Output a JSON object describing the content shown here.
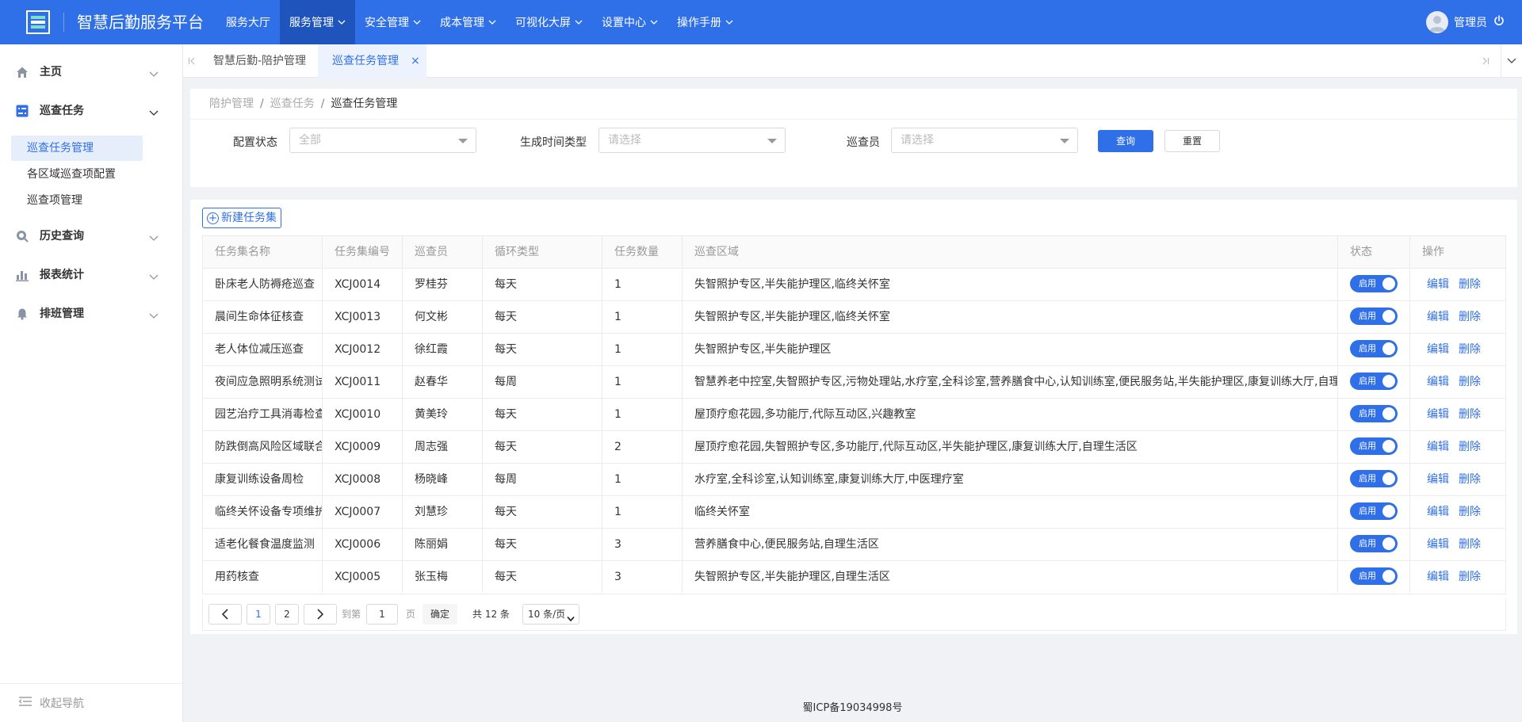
{
  "header": {
    "app_title": "智慧后勤服务平台",
    "nav": [
      {
        "label": "服务大厅",
        "dropdown": false,
        "active": false
      },
      {
        "label": "服务管理",
        "dropdown": true,
        "active": true
      },
      {
        "label": "安全管理",
        "dropdown": true,
        "active": false
      },
      {
        "label": "成本管理",
        "dropdown": true,
        "active": false
      },
      {
        "label": "可视化大屏",
        "dropdown": true,
        "active": false
      },
      {
        "label": "设置中心",
        "dropdown": true,
        "active": false
      },
      {
        "label": "操作手册",
        "dropdown": true,
        "active": false
      }
    ],
    "user_name": "管理员"
  },
  "sidebar": {
    "groups": [
      {
        "label": "主页",
        "icon": "home-icon",
        "expanded": false
      },
      {
        "label": "巡查任务",
        "icon": "task-list-icon",
        "expanded": true
      },
      {
        "label": "历史查询",
        "icon": "history-search-icon",
        "expanded": false
      },
      {
        "label": "报表统计",
        "icon": "bar-chart-icon",
        "expanded": false
      },
      {
        "label": "排班管理",
        "icon": "bell-icon",
        "expanded": false
      }
    ],
    "sub_items": [
      {
        "label": "巡查任务管理",
        "active": true
      },
      {
        "label": "各区域巡查项配置",
        "active": false
      },
      {
        "label": "巡查项管理",
        "active": false
      }
    ],
    "collapse_label": "收起导航"
  },
  "tabs": [
    {
      "label": "智慧后勤-陪护管理",
      "active": false
    },
    {
      "label": "巡查任务管理",
      "active": true,
      "closable": true
    }
  ],
  "breadcrumb": [
    "陪护管理",
    "巡查任务",
    "巡查任务管理"
  ],
  "filters": {
    "status_label": "配置状态",
    "status_value": "全部",
    "time_type_label": "生成时间类型",
    "time_type_placeholder": "请选择",
    "inspector_label": "巡查员",
    "inspector_placeholder": "请选择",
    "query_label": "查询",
    "reset_label": "重置"
  },
  "new_button_label": "新建任务集",
  "table": {
    "columns": [
      "任务集名称",
      "任务集编号",
      "巡查员",
      "循环类型",
      "任务数量",
      "巡查区域",
      "状态",
      "操作"
    ],
    "toggle_label": "启用",
    "edit_label": "编辑",
    "delete_label": "删除",
    "rows": [
      {
        "name": "卧床老人防褥疮巡查",
        "code": "XCJ0014",
        "inspector": "罗桂芬",
        "cycle": "每天",
        "count": "1",
        "area": "失智照护专区,半失能护理区,临终关怀室",
        "enabled": true
      },
      {
        "name": "晨间生命体征核查",
        "code": "XCJ0013",
        "inspector": "何文彬",
        "cycle": "每天",
        "count": "1",
        "area": "失智照护专区,半失能护理区,临终关怀室",
        "enabled": true
      },
      {
        "name": "老人体位减压巡查",
        "code": "XCJ0012",
        "inspector": "徐红霞",
        "cycle": "每天",
        "count": "1",
        "area": "失智照护专区,半失能护理区",
        "enabled": true
      },
      {
        "name": "夜间应急照明系统测试",
        "code": "XCJ0011",
        "inspector": "赵春华",
        "cycle": "每周",
        "count": "1",
        "area": "智慧养老中控室,失智照护专区,污物处理站,水疗室,全科诊室,营养膳食中心,认知训练室,便民服务站,半失能护理区,康复训练大厅,自理生活区",
        "enabled": true
      },
      {
        "name": "园艺治疗工具消毒检查",
        "code": "XCJ0010",
        "inspector": "黄美玲",
        "cycle": "每天",
        "count": "1",
        "area": "屋顶疗愈花园,多功能厅,代际互动区,兴趣教室",
        "enabled": true
      },
      {
        "name": "防跌倒高风险区域联合巡查",
        "code": "XCJ0009",
        "inspector": "周志强",
        "cycle": "每天",
        "count": "2",
        "area": "屋顶疗愈花园,失智照护专区,多功能厅,代际互动区,半失能护理区,康复训练大厅,自理生活区",
        "enabled": true
      },
      {
        "name": "康复训练设备周检",
        "code": "XCJ0008",
        "inspector": "杨晓峰",
        "cycle": "每周",
        "count": "1",
        "area": "水疗室,全科诊室,认知训练室,康复训练大厅,中医理疗室",
        "enabled": true
      },
      {
        "name": "临终关怀设备专项维护",
        "code": "XCJ0007",
        "inspector": "刘慧珍",
        "cycle": "每天",
        "count": "1",
        "area": "临终关怀室",
        "enabled": true
      },
      {
        "name": "适老化餐食温度监测",
        "code": "XCJ0006",
        "inspector": "陈丽娟",
        "cycle": "每天",
        "count": "3",
        "area": "营养膳食中心,便民服务站,自理生活区",
        "enabled": true
      },
      {
        "name": "用药核查",
        "code": "XCJ0005",
        "inspector": "张玉梅",
        "cycle": "每天",
        "count": "3",
        "area": "失智照护专区,半失能护理区,自理生活区",
        "enabled": true
      }
    ]
  },
  "pagination": {
    "pages": [
      "1",
      "2"
    ],
    "current_page": "1",
    "goto_prefix": "到第",
    "goto_value": "1",
    "goto_suffix": "页",
    "confirm_label": "确定",
    "total_text": "共 12 条",
    "page_size": "10 条/页"
  },
  "footer": {
    "icp": "蜀ICP备19034998号"
  },
  "colors": {
    "primary": "#2f6fe8",
    "header_bg": "#2f6fe8",
    "nav_active_bg": "#1e54bb"
  }
}
